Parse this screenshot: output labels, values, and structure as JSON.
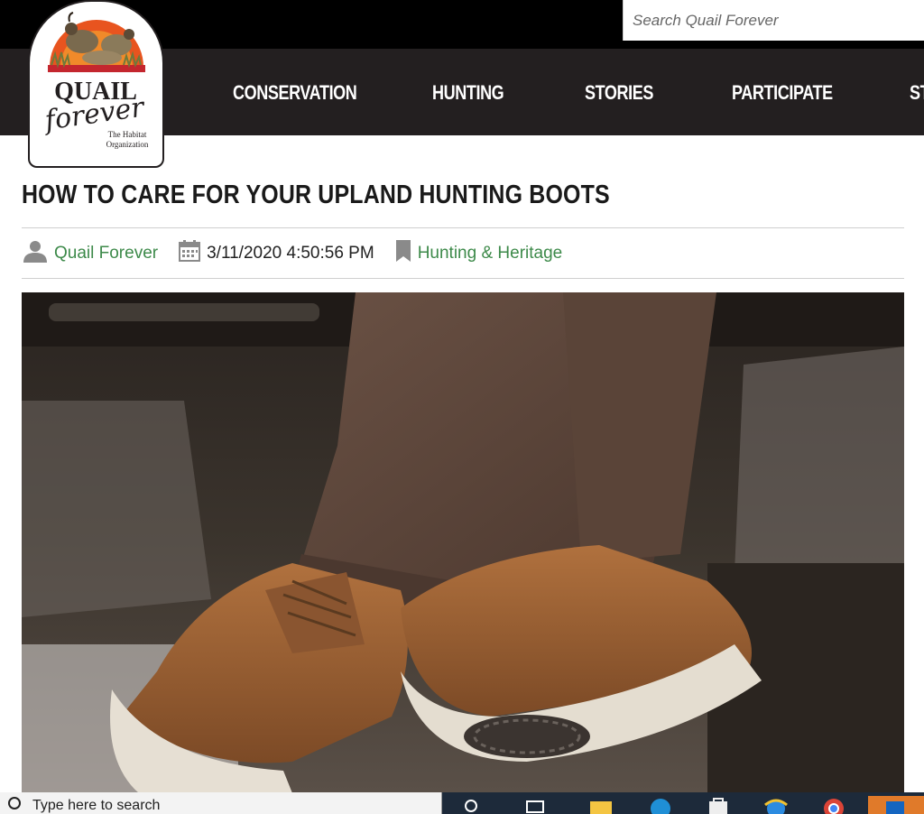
{
  "search": {
    "placeholder": "Search Quail Forever"
  },
  "logo": {
    "line1": "QUAIL",
    "line2": "forever",
    "tag1": "The Habitat",
    "tag2": "Organization"
  },
  "nav": {
    "items": [
      {
        "label": "CONSERVATION"
      },
      {
        "label": "HUNTING"
      },
      {
        "label": "STORIES"
      },
      {
        "label": "PARTICIPATE"
      },
      {
        "label": "ST"
      }
    ]
  },
  "article": {
    "title": "HOW TO CARE FOR YOUR UPLAND HUNTING BOOTS",
    "author": "Quail Forever",
    "date": "3/11/2020 4:50:56 PM",
    "category": "Hunting & Heritage",
    "hero_image": "boots-photo"
  },
  "taskbar": {
    "search_text": "Type here to search",
    "icons": [
      "search-icon",
      "task-view-icon",
      "file-explorer-icon",
      "edge-icon",
      "store-icon",
      "ie-icon",
      "chrome-icon",
      "outlook-icon"
    ]
  },
  "colors": {
    "nav_bg": "#231f20",
    "link_green": "#3d8a4a",
    "topbar": "#000000"
  }
}
